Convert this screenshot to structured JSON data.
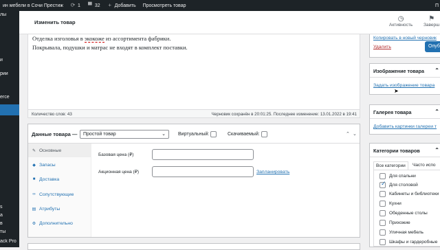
{
  "admin_bar": {
    "site_name": "ин мебели в Сочи Престиж",
    "updates_count": "1",
    "comments_count": "32",
    "add_label": "Добавить",
    "view_label": "Просмотреть товар",
    "right_text": "П"
  },
  "side_menu": {
    "items": [
      "лы",
      "и",
      "рии",
      "erce",
      "s",
      "а",
      "в",
      "ты",
      "ack Pro"
    ]
  },
  "topbar": {
    "title": "Изменить товар",
    "activity_label": "Активность",
    "finish_label": "Заверш"
  },
  "editor": {
    "line1_before": "Отделка изголовья в ",
    "line1_link": "экокоже",
    "line1_after": " из ассортимента фабрики.",
    "line2": "Покрывала, подушки и матрас не входят в комплект поставки.",
    "word_count": "Количество слов: 43",
    "draft_status": "Черновик сохранён в 20:01:25. Последнее изменение: 13.01.2022 в 19:41"
  },
  "product_data": {
    "title": "Данные товара —",
    "type_selected": "Простой товар",
    "virtual_label": "Виртуальный:",
    "downloadable_label": "Скачиваемый:",
    "tabs": [
      "Основные",
      "Запасы",
      "Доставка",
      "Сопутствующие",
      "Атрибуты",
      "Дополнительно"
    ],
    "regular_price_label": "Базовая цена (₽)",
    "sale_price_label": "Акционная цена (₽)",
    "schedule_label": "Запланировать"
  },
  "publish": {
    "copy_link": "Копировать в новый черновик",
    "delete_link": "Удалить",
    "publish_button": "Опуб"
  },
  "product_image": {
    "title": "Изображение товара",
    "set_link": "Задать изображение товара"
  },
  "gallery": {
    "title": "Галерея товара",
    "add_link": "Добавить картинки галереи т"
  },
  "categories": {
    "title": "Категории товаров",
    "tab_all": "Все категории",
    "tab_popular": "Часто испо",
    "items": [
      {
        "label": "Для спальни",
        "checked": false
      },
      {
        "label": "Для столовой",
        "checked": true
      },
      {
        "label": "Кабинеты и библиотеки",
        "checked": false
      },
      {
        "label": "Кухни",
        "checked": false
      },
      {
        "label": "Обеденные столы",
        "checked": false
      },
      {
        "label": "Прихожие",
        "checked": false
      },
      {
        "label": "Уличная мебель",
        "checked": false
      },
      {
        "label": "Шкафы и гардеробные",
        "checked": false
      }
    ]
  }
}
